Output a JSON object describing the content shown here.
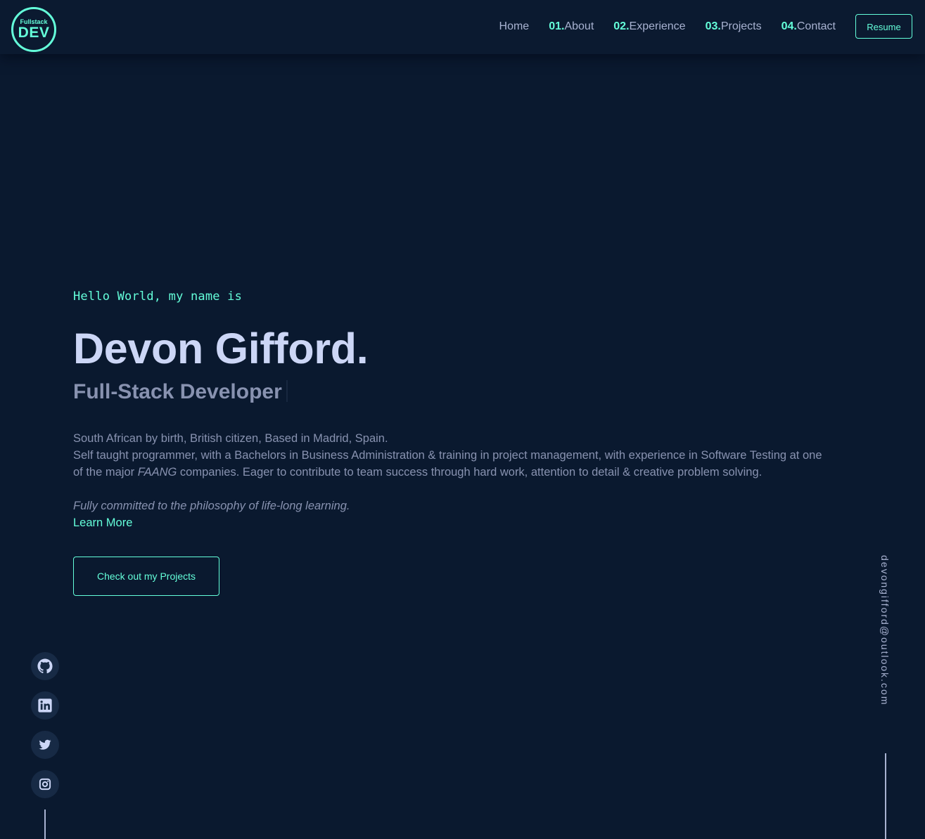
{
  "logo": {
    "top_text": "Fullstack",
    "main_text": "DEV"
  },
  "nav": {
    "items": [
      {
        "number": "",
        "label": "Home"
      },
      {
        "number": "01.",
        "label": "About"
      },
      {
        "number": "02.",
        "label": "Experience"
      },
      {
        "number": "03.",
        "label": "Projects"
      },
      {
        "number": "04.",
        "label": "Contact"
      }
    ],
    "resume_label": "Resume"
  },
  "hero": {
    "greeting": "Hello World, my name is",
    "name": "Devon Gifford.",
    "role": "Full-Stack Developer",
    "bio_line1": "South African by birth, British citizen, Based in Madrid, Spain.",
    "bio_line2_before": "Self taught programmer, with a Bachelors in Business Administration & training in project management, with experience in Software Testing at one of the major ",
    "bio_emphasis": "FAANG",
    "bio_line2_after": " companies. Eager to contribute to team success through hard work, attention to detail & creative problem solving.",
    "philosophy": "Fully committed to the philosophy of life-long learning.",
    "learn_more": "Learn More",
    "cta_label": "Check out my Projects"
  },
  "social": {
    "icons": [
      "github-icon",
      "linkedin-icon",
      "twitter-icon",
      "instagram-icon"
    ]
  },
  "contact": {
    "email": "devongifford@outlook.com"
  },
  "colors": {
    "background": "#0a192f",
    "header": "#0b1a30",
    "accent": "#64ffda",
    "heading": "#ccd6f6",
    "text": "#8892b0",
    "nav_text": "#a8b2d1",
    "social_bg": "#172a45"
  }
}
